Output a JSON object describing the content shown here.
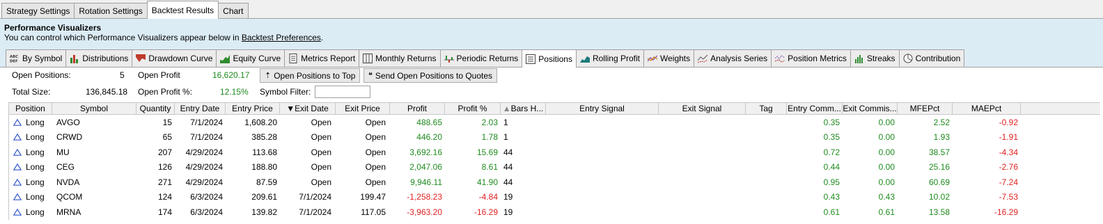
{
  "top_tabs": [
    {
      "label": "Strategy Settings"
    },
    {
      "label": "Rotation Settings"
    },
    {
      "label": "Backtest Results"
    },
    {
      "label": "Chart"
    }
  ],
  "header": {
    "title": "Performance Visualizers",
    "subtitle_prefix": "You can control which Performance Visualizers appear below in ",
    "link": "Backtest Preferences",
    "subtitle_suffix": "."
  },
  "viz_tabs": [
    {
      "label": "By Symbol",
      "icon": "abc-def-icon"
    },
    {
      "label": "Distributions",
      "icon": "bar-chart-icon"
    },
    {
      "label": "Drawdown Curve",
      "icon": "drawdown-icon"
    },
    {
      "label": "Equity Curve",
      "icon": "equity-curve-icon"
    },
    {
      "label": "Metrics Report",
      "icon": "report-icon"
    },
    {
      "label": "Monthly Returns",
      "icon": "monthly-returns-icon"
    },
    {
      "label": "Periodic Returns",
      "icon": "periodic-returns-icon"
    },
    {
      "label": "Positions",
      "icon": "positions-list-icon"
    },
    {
      "label": "Rolling Profit",
      "icon": "rolling-profit-icon"
    },
    {
      "label": "Weights",
      "icon": "weights-icon"
    },
    {
      "label": "Analysis Series",
      "icon": "analysis-series-icon"
    },
    {
      "label": "Position Metrics",
      "icon": "position-metrics-icon"
    },
    {
      "label": "Streaks",
      "icon": "streaks-icon"
    },
    {
      "label": "Contribution",
      "icon": "pie-icon"
    }
  ],
  "summary": {
    "open_positions_label": "Open Positions:",
    "open_positions_value": "5",
    "open_profit_label": "Open Profit",
    "open_profit_value": "16,620.17",
    "total_size_label": "Total Size:",
    "total_size_value": "136,845.18",
    "open_profit_pct_label": "Open Profit %:",
    "open_profit_pct_value": "12.15%",
    "symbol_filter_label": "Symbol Filter:",
    "symbol_filter_value": "",
    "btn_open_positions_top": "Open Positions to Top",
    "btn_send_quotes": "Send Open Positions to Quotes"
  },
  "columns": [
    "Position",
    "Symbol",
    "Quantity",
    "Entry Date",
    "Entry Price",
    "Exit Date",
    "Exit Price",
    "Profit",
    "Profit %",
    "Bars H...",
    "Entry Signal",
    "Exit Signal",
    "Tag",
    "Entry Comm...",
    "Exit Commis...",
    "MFEPct",
    "MAEPct"
  ],
  "sorted": {
    "exit_date": "descending",
    "bars_held": "ascending"
  },
  "rows": [
    {
      "position": "Long",
      "symbol": "AVGO",
      "quantity": "15",
      "entry_date": "7/1/2024",
      "entry_price": "1,608.20",
      "exit_date": "Open",
      "exit_price": "Open",
      "profit": "488.65",
      "profit_pct": "2.03",
      "bars": "1",
      "entry_signal": "",
      "exit_signal": "",
      "tag": "",
      "entry_comm": "0.35",
      "exit_comm": "0.00",
      "mfe": "2.52",
      "mae": "-0.92"
    },
    {
      "position": "Long",
      "symbol": "CRWD",
      "quantity": "65",
      "entry_date": "7/1/2024",
      "entry_price": "385.28",
      "exit_date": "Open",
      "exit_price": "Open",
      "profit": "446.20",
      "profit_pct": "1.78",
      "bars": "1",
      "entry_signal": "",
      "exit_signal": "",
      "tag": "",
      "entry_comm": "0.35",
      "exit_comm": "0.00",
      "mfe": "1.93",
      "mae": "-1.91"
    },
    {
      "position": "Long",
      "symbol": "MU",
      "quantity": "207",
      "entry_date": "4/29/2024",
      "entry_price": "113.68",
      "exit_date": "Open",
      "exit_price": "Open",
      "profit": "3,692.16",
      "profit_pct": "15.69",
      "bars": "44",
      "entry_signal": "",
      "exit_signal": "",
      "tag": "",
      "entry_comm": "0.72",
      "exit_comm": "0.00",
      "mfe": "38.57",
      "mae": "-4.34"
    },
    {
      "position": "Long",
      "symbol": "CEG",
      "quantity": "126",
      "entry_date": "4/29/2024",
      "entry_price": "188.80",
      "exit_date": "Open",
      "exit_price": "Open",
      "profit": "2,047.06",
      "profit_pct": "8.61",
      "bars": "44",
      "entry_signal": "",
      "exit_signal": "",
      "tag": "",
      "entry_comm": "0.44",
      "exit_comm": "0.00",
      "mfe": "25.16",
      "mae": "-2.76"
    },
    {
      "position": "Long",
      "symbol": "NVDA",
      "quantity": "271",
      "entry_date": "4/29/2024",
      "entry_price": "87.59",
      "exit_date": "Open",
      "exit_price": "Open",
      "profit": "9,946.11",
      "profit_pct": "41.90",
      "bars": "44",
      "entry_signal": "",
      "exit_signal": "",
      "tag": "",
      "entry_comm": "0.95",
      "exit_comm": "0.00",
      "mfe": "60.69",
      "mae": "-7.24"
    },
    {
      "position": "Long",
      "symbol": "QCOM",
      "quantity": "124",
      "entry_date": "6/3/2024",
      "entry_price": "209.61",
      "exit_date": "7/1/2024",
      "exit_price": "199.47",
      "profit": "-1,258.23",
      "profit_pct": "-4.84",
      "bars": "19",
      "entry_signal": "",
      "exit_signal": "",
      "tag": "",
      "entry_comm": "0.43",
      "exit_comm": "0.43",
      "mfe": "10.02",
      "mae": "-7.53"
    },
    {
      "position": "Long",
      "symbol": "MRNA",
      "quantity": "174",
      "entry_date": "6/3/2024",
      "entry_price": "139.82",
      "exit_date": "7/1/2024",
      "exit_price": "117.05",
      "profit": "-3,963.20",
      "profit_pct": "-16.29",
      "bars": "19",
      "entry_signal": "",
      "exit_signal": "",
      "tag": "",
      "entry_comm": "0.61",
      "exit_comm": "0.61",
      "mfe": "13.58",
      "mae": "-16.29"
    }
  ],
  "colors": {
    "positive": "#1e8a1e",
    "negative": "#e02020",
    "header_bg": "#dcecf5",
    "long_icon": "#3355cc"
  }
}
